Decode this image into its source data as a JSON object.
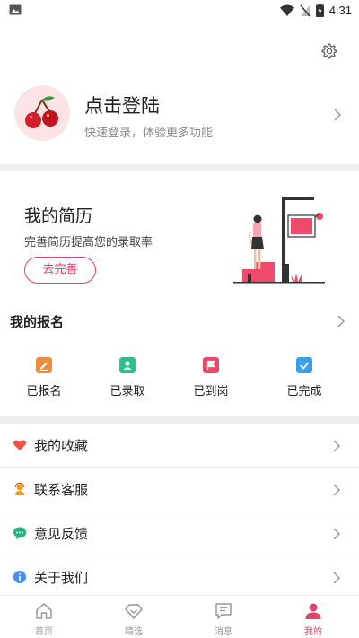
{
  "status_bar": {
    "time": "4:31"
  },
  "profile": {
    "title": "点击登陆",
    "subtitle": "快速登录，体验更多功能"
  },
  "resume": {
    "title": "我的简历",
    "subtitle": "完善简历提高您的录取率",
    "button": "去完善"
  },
  "registration": {
    "title": "我的报名",
    "items": [
      {
        "label": "已报名",
        "color": "#f08a3c",
        "icon": "edit-icon"
      },
      {
        "label": "已录取",
        "color": "#2fbf8f",
        "icon": "user-card-icon"
      },
      {
        "label": "已到岗",
        "color": "#ef4566",
        "icon": "flag-icon"
      },
      {
        "label": "已完成",
        "color": "#3aa0ee",
        "icon": "check-icon"
      }
    ]
  },
  "menu": [
    {
      "label": "我的收藏",
      "icon": "heart-icon",
      "color": "#f0524a"
    },
    {
      "label": "联系客服",
      "icon": "customer-service-icon",
      "color": "#f39a1e"
    },
    {
      "label": "意见反馈",
      "icon": "feedback-icon",
      "color": "#22b47a"
    },
    {
      "label": "关于我们",
      "icon": "info-icon",
      "color": "#4a8ef0"
    }
  ],
  "tabs": [
    {
      "label": "首页",
      "icon": "home-icon"
    },
    {
      "label": "精选",
      "icon": "diamond-icon"
    },
    {
      "label": "消息",
      "icon": "message-icon"
    },
    {
      "label": "我的",
      "icon": "person-icon",
      "active": true
    }
  ],
  "accent_color": "#e0436a"
}
